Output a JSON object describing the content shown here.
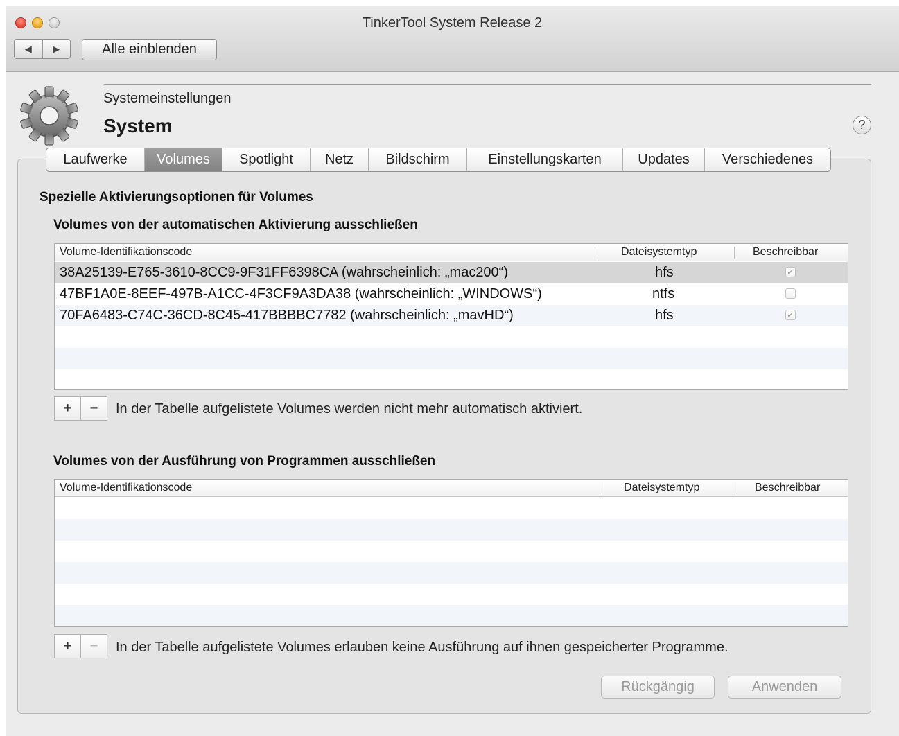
{
  "window": {
    "title": "TinkerTool System Release 2",
    "nav_back": "◀",
    "nav_forward": "▶",
    "show_all_label": "Alle einblenden"
  },
  "header": {
    "icon": "gear-icon",
    "subtitle": "Systemeinstellungen",
    "title": "System",
    "help_label": "?"
  },
  "tabs": [
    {
      "label": "Laufwerke",
      "active": false
    },
    {
      "label": "Volumes",
      "active": true
    },
    {
      "label": "Spotlight",
      "active": false
    },
    {
      "label": "Netz",
      "active": false
    },
    {
      "label": "Bildschirm",
      "active": false
    },
    {
      "label": "Einstellungskarten",
      "active": false
    },
    {
      "label": "Updates",
      "active": false
    },
    {
      "label": "Verschiedenes",
      "active": false
    }
  ],
  "main": {
    "section_title": "Spezielle Aktivierungsoptionen für Volumes",
    "mount_section": {
      "title": "Volumes von der automatischen Aktivierung ausschließen",
      "columns": [
        "Volume-Identifikationscode",
        "Dateisystemtyp",
        "Beschreibbar"
      ],
      "rows": [
        {
          "id": "38A25139-E765-3610-8CC9-9F31FF6398CA (wahrscheinlich: „mac200“)",
          "fs": "hfs",
          "writable": true,
          "selected": true
        },
        {
          "id": "47BF1A0E-8EEF-497B-A1CC-4F3CF9A3DA38 (wahrscheinlich: „WINDOWS“)",
          "fs": "ntfs",
          "writable": false,
          "selected": false
        },
        {
          "id": "70FA6483-C74C-36CD-8C45-417BBBBC7782 (wahrscheinlich: „mavHD“)",
          "fs": "hfs",
          "writable": true,
          "selected": false
        }
      ],
      "add_label": "+",
      "remove_label": "−",
      "note": "In der Tabelle aufgelistete Volumes werden nicht mehr automatisch aktiviert."
    },
    "exec_section": {
      "title": "Volumes von der Ausführung von Programmen ausschließen",
      "columns": [
        "Volume-Identifikationscode",
        "Dateisystemtyp",
        "Beschreibbar"
      ],
      "rows": [],
      "add_label": "+",
      "remove_label": "−",
      "note": "In der Tabelle aufgelistete Volumes erlauben keine Ausführung auf ihnen gespeicherter Programme."
    },
    "revert_label": "Rückgängig",
    "apply_label": "Anwenden"
  },
  "colors": {
    "selected_row": "#d6d6d6",
    "active_tab": "#8f8f8f",
    "alt_row": "#f2f5fa"
  }
}
